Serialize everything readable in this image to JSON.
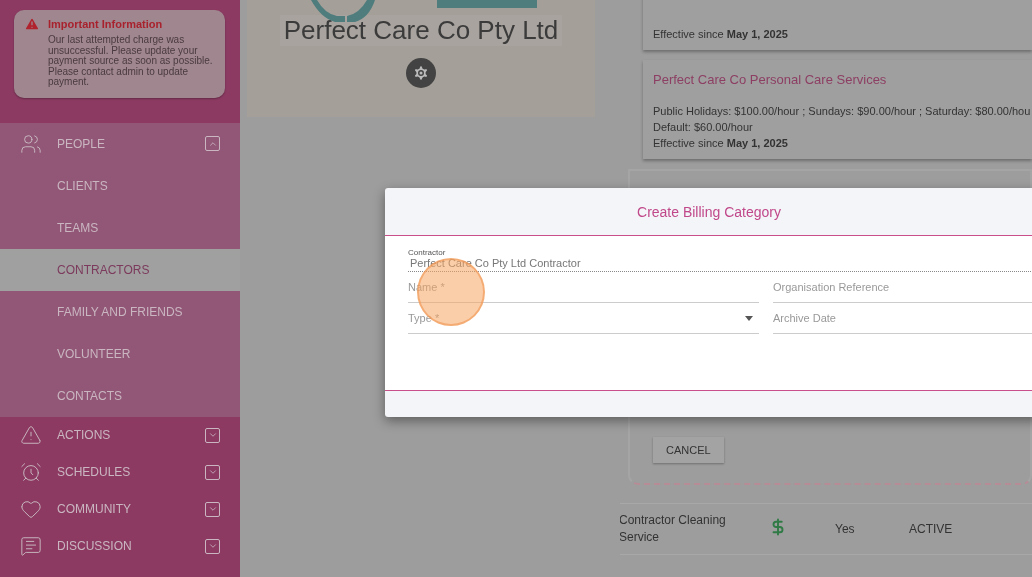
{
  "alert": {
    "title": "Important Information",
    "message": "Our last attempted charge was unsuccessful. Please update your payment source as soon as possible. Please contact admin to update payment."
  },
  "sidebar": {
    "items": [
      {
        "kind": "people",
        "label": "PEOPLE",
        "expanded": true,
        "children": [
          {
            "label": "CLIENTS",
            "selected": false
          },
          {
            "label": "TEAMS",
            "selected": false
          },
          {
            "label": "CONTRACTORS",
            "selected": true
          },
          {
            "label": "FAMILY AND FRIENDS",
            "selected": false
          },
          {
            "label": "VOLUNTEER",
            "selected": false
          },
          {
            "label": "CONTACTS",
            "selected": false
          }
        ]
      },
      {
        "kind": "actions",
        "label": "ACTIONS",
        "expanded": false
      },
      {
        "kind": "schedules",
        "label": "SCHEDULES",
        "expanded": false
      },
      {
        "kind": "community",
        "label": "COMMUNITY",
        "expanded": false
      },
      {
        "kind": "discussion",
        "label": "DISCUSSION",
        "expanded": false
      }
    ]
  },
  "company": {
    "name": "Perfect Care Co Pty Ltd"
  },
  "cards": [
    {
      "lines": [
        "Effective since **May 1, 2025**"
      ]
    },
    {
      "title": "Perfect Care Co Personal Care Services",
      "lines": [
        "Public Holidays: $100.00/hour ; Sundays: $90.00/hour ; Saturday: $80.00/hou",
        "Default: $60.00/hour",
        "Effective since **May 1, 2025**"
      ]
    }
  ],
  "cancel_button": "CANCEL",
  "table": {
    "rows": [
      {
        "name": "Contractor Cleaning Service",
        "billable": "Yes",
        "status": "ACTIVE"
      }
    ]
  },
  "modal": {
    "title": "Create Billing Category",
    "fields": [
      {
        "kind": "readonly",
        "label": "Contractor",
        "value": "Perfect Care Co Pty Ltd Contractor"
      },
      {
        "kind": "text",
        "placeholder": "Name *"
      },
      {
        "kind": "text",
        "placeholder": "Organisation Reference"
      },
      {
        "kind": "select",
        "placeholder": "Type *"
      },
      {
        "kind": "text",
        "placeholder": "Archive Date"
      }
    ]
  }
}
